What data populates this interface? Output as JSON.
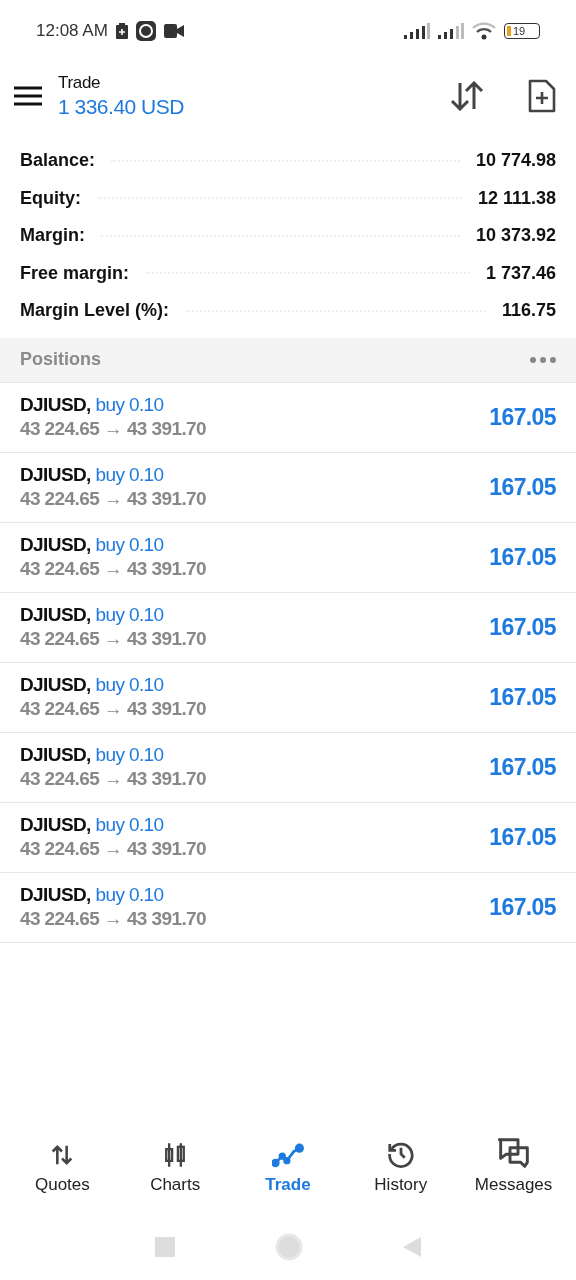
{
  "status_bar": {
    "time": "12:08 AM",
    "battery": "19"
  },
  "header": {
    "title": "Trade",
    "amount": "1 336.40 USD"
  },
  "summary": [
    {
      "label": "Balance:",
      "value": "10 774.98"
    },
    {
      "label": "Equity:",
      "value": "12 111.38"
    },
    {
      "label": "Margin:",
      "value": "10 373.92"
    },
    {
      "label": "Free margin:",
      "value": "1 737.46"
    },
    {
      "label": "Margin Level (%):",
      "value": "116.75"
    }
  ],
  "positions_title": "Positions",
  "positions": [
    {
      "symbol": "DJIUSD,",
      "side": "buy 0.10",
      "prices": "43 224.65 → 43 391.70",
      "profit": "167.05"
    },
    {
      "symbol": "DJIUSD,",
      "side": "buy 0.10",
      "prices": "43 224.65 → 43 391.70",
      "profit": "167.05"
    },
    {
      "symbol": "DJIUSD,",
      "side": "buy 0.10",
      "prices": "43 224.65 → 43 391.70",
      "profit": "167.05"
    },
    {
      "symbol": "DJIUSD,",
      "side": "buy 0.10",
      "prices": "43 224.65 → 43 391.70",
      "profit": "167.05"
    },
    {
      "symbol": "DJIUSD,",
      "side": "buy 0.10",
      "prices": "43 224.65 → 43 391.70",
      "profit": "167.05"
    },
    {
      "symbol": "DJIUSD,",
      "side": "buy 0.10",
      "prices": "43 224.65 → 43 391.70",
      "profit": "167.05"
    },
    {
      "symbol": "DJIUSD,",
      "side": "buy 0.10",
      "prices": "43 224.65 → 43 391.70",
      "profit": "167.05"
    },
    {
      "symbol": "DJIUSD,",
      "side": "buy 0.10",
      "prices": "43 224.65 → 43 391.70",
      "profit": "167.05"
    }
  ],
  "nav": [
    {
      "kind": "quotes",
      "label": "Quotes",
      "selected": false
    },
    {
      "kind": "charts",
      "label": "Charts",
      "selected": false
    },
    {
      "kind": "trade",
      "label": "Trade",
      "selected": true
    },
    {
      "kind": "history",
      "label": "History",
      "selected": false
    },
    {
      "kind": "messages",
      "label": "Messages",
      "selected": false
    }
  ]
}
